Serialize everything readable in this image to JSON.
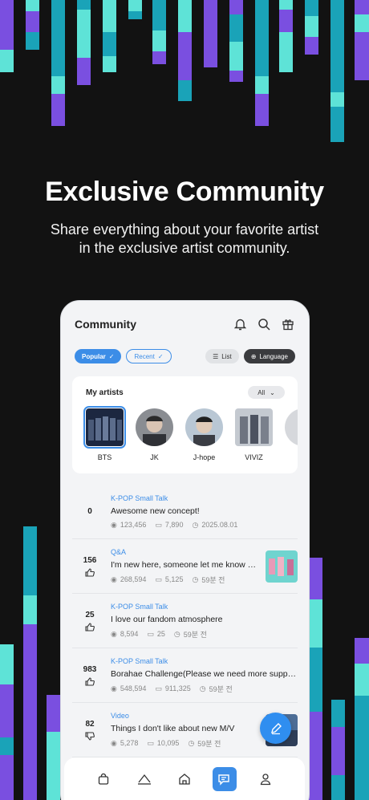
{
  "hero": {
    "title": "Exclusive Community",
    "subtitle_line1": "Share everything about your favorite artist",
    "subtitle_line2": "in the exclusive artist community."
  },
  "app": {
    "title": "Community",
    "icons": [
      "bell-icon",
      "search-icon",
      "gift-icon"
    ],
    "filters": {
      "popular": "Popular",
      "recent": "Recent",
      "list": "List",
      "language": "Language"
    },
    "my_artists": {
      "title": "My artists",
      "dropdown": "All",
      "items": [
        {
          "name": "BTS"
        },
        {
          "name": "JK"
        },
        {
          "name": "J-hope"
        },
        {
          "name": "VIVIZ"
        }
      ]
    },
    "posts": [
      {
        "score": "0",
        "category": "K-POP Small Talk",
        "title": "Awesome new concept!",
        "views": "123,456",
        "comments": "7,890",
        "time": "2025.08.01"
      },
      {
        "score": "156",
        "category": "Q&A",
        "title": "I'm new here, someone let me know how...",
        "views": "268,594",
        "comments": "5,125",
        "time": "59분 전"
      },
      {
        "score": "25",
        "category": "K-POP Small Talk",
        "title": "I love our fandom atmosphere",
        "views": "8,594",
        "comments": "25",
        "time": "59분 전"
      },
      {
        "score": "983",
        "category": "K-POP Small Talk",
        "title": "Borahae Challenge(Please we need more support)",
        "views": "548,594",
        "comments": "911,325",
        "time": "59분 전"
      },
      {
        "score": "82",
        "category": "Video",
        "title": "Things I don't like about new M/V",
        "views": "5,278",
        "comments": "10,095",
        "time": "59분 전"
      }
    ],
    "nav": [
      "shop-icon",
      "artist-icon",
      "home-icon",
      "community-icon",
      "profile-icon"
    ],
    "colors": {
      "accent": "#3c8de7",
      "teal": "#1aa3b8",
      "purple": "#7a4fe0",
      "mint": "#5ee3d7"
    }
  }
}
